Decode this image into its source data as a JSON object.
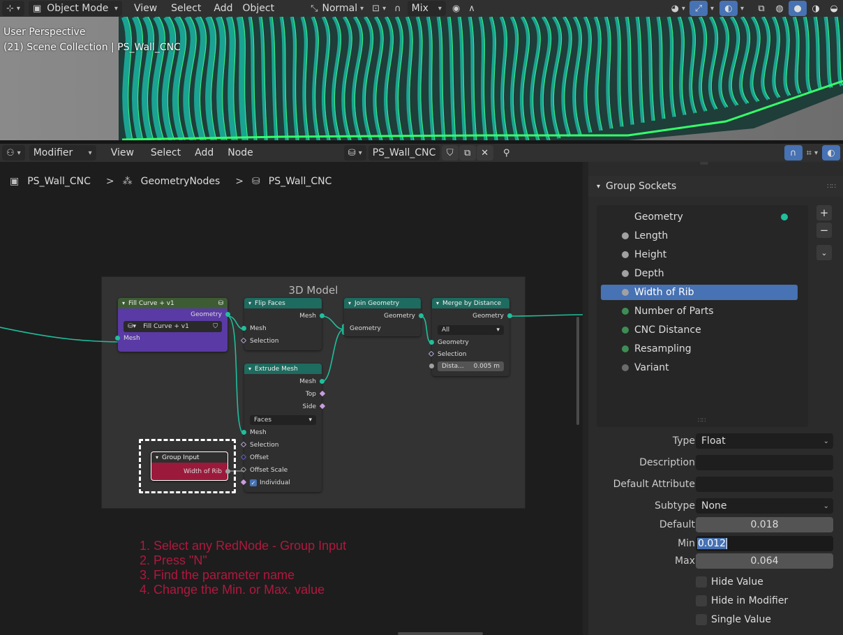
{
  "top_header": {
    "mode": "Object Mode",
    "menus": [
      "View",
      "Select",
      "Add",
      "Object"
    ],
    "transform_orientation": "Normal",
    "snap_mode": "Mix"
  },
  "viewport": {
    "line1": "User Perspective",
    "line2": "(21) Scene Collection | PS_Wall_CNC"
  },
  "node_header": {
    "editor_type": "Modifier",
    "menus": [
      "View",
      "Select",
      "Add",
      "Node"
    ],
    "node_group": "PS_Wall_CNC"
  },
  "breadcrumb": {
    "object": "PS_Wall_CNC",
    "modifier": "GeometryNodes",
    "group": "PS_Wall_CNC"
  },
  "frame": {
    "label": "3D Model"
  },
  "nodes": {
    "fill_curve": {
      "title": "Fill Curve + v1",
      "out_geometry": "Geometry",
      "selector": "Fill Curve + v1",
      "in_mesh": "Mesh"
    },
    "flip_faces": {
      "title": "Flip Faces",
      "out_mesh": "Mesh",
      "in_mesh": "Mesh",
      "in_selection": "Selection"
    },
    "join_geometry": {
      "title": "Join Geometry",
      "out_geometry": "Geometry",
      "in_geometry": "Geometry"
    },
    "merge_by_distance": {
      "title": "Merge by Distance",
      "out_geometry": "Geometry",
      "mode": "All",
      "in_geometry": "Geometry",
      "in_selection": "Selection",
      "distance_label": "Dista...",
      "distance_value": "0.005 m"
    },
    "extrude_mesh": {
      "title": "Extrude Mesh",
      "out_mesh": "Mesh",
      "out_top": "Top",
      "out_side": "Side",
      "mode": "Faces",
      "in_mesh": "Mesh",
      "in_selection": "Selection",
      "in_offset": "Offset",
      "in_offset_scale": "Offset Scale",
      "in_individual": "Individual"
    },
    "group_input": {
      "title": "Group Input",
      "out_socket": "Width of Rib"
    }
  },
  "instructions": [
    "1. Select any RedNode - Group Input",
    "2. Press \"N\"",
    "3. Find the parameter name",
    "4. Change the Min. or Max. value"
  ],
  "sidebar": {
    "panel_title": "Group Sockets",
    "sockets": [
      {
        "name": "Geometry",
        "color": "#1fbf9c"
      },
      {
        "name": "Length",
        "color": "#a1a1a1"
      },
      {
        "name": "Height",
        "color": "#a1a1a1"
      },
      {
        "name": "Depth",
        "color": "#a1a1a1"
      },
      {
        "name": "Width of Rib",
        "color": "#a1a1a1"
      },
      {
        "name": "Number of Parts",
        "color": "#3e8d55"
      },
      {
        "name": "CNC Distance",
        "color": "#3e8d55"
      },
      {
        "name": "Resampling",
        "color": "#3e8d55"
      },
      {
        "name": "Variant",
        "color": "#6b6b6b"
      }
    ],
    "selected_index": 4,
    "props": {
      "type_label": "Type",
      "type_value": "Float",
      "description_label": "Description",
      "description_value": "",
      "default_attribute_label": "Default Attribute",
      "default_attribute_value": "",
      "subtype_label": "Subtype",
      "subtype_value": "None",
      "default_label": "Default",
      "default_value": "0.018",
      "min_label": "Min",
      "min_value": "0.012",
      "max_label": "Max",
      "max_value": "0.064"
    },
    "checkboxes": [
      "Hide Value",
      "Hide in Modifier",
      "Single Value"
    ]
  },
  "colors": {
    "accent": "#4772b3",
    "geometry_socket": "#1fbf9c",
    "group_input_red": "#9b1a3c",
    "instructions_red": "#b0183e"
  }
}
